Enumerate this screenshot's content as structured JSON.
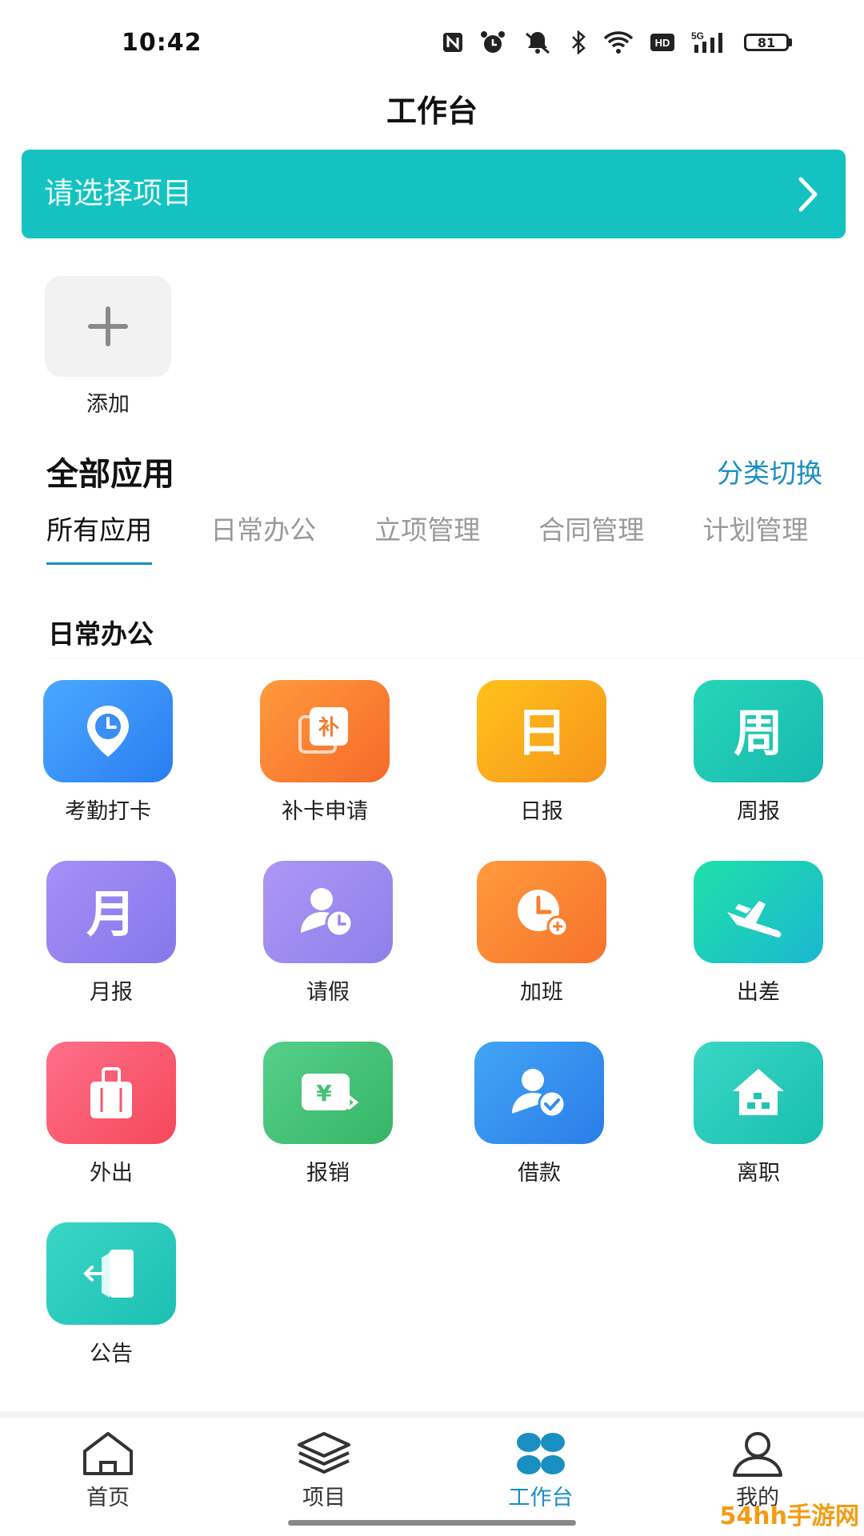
{
  "status_bar": {
    "time": "10:42",
    "battery": "81",
    "network": "5G",
    "hd": "HD"
  },
  "header": {
    "title": "工作台"
  },
  "project_selector": {
    "placeholder": "请选择项目"
  },
  "shortcut": {
    "add_label": "添加"
  },
  "all_apps": {
    "title": "全部应用",
    "switch_label": "分类切换"
  },
  "tabs": [
    {
      "label": "所有应用",
      "active": true
    },
    {
      "label": "日常办公",
      "active": false
    },
    {
      "label": "立项管理",
      "active": false
    },
    {
      "label": "合同管理",
      "active": false
    },
    {
      "label": "计划管理",
      "active": false
    }
  ],
  "group": {
    "title": "日常办公"
  },
  "apps": [
    {
      "label": "考勤打卡",
      "icon": "clock-pin-icon",
      "color": "#3a8ef6"
    },
    {
      "label": "补卡申请",
      "icon": "supplement-card-icon",
      "color": "#f77b2e",
      "glyph": "补"
    },
    {
      "label": "日报",
      "icon": "daily-report-icon",
      "color": "#f9a514",
      "glyph": "日"
    },
    {
      "label": "周报",
      "icon": "weekly-report-icon",
      "color": "#1bc6b0",
      "glyph": "周"
    },
    {
      "label": "月报",
      "icon": "monthly-report-icon",
      "color": "#9183f0",
      "glyph": "月"
    },
    {
      "label": "请假",
      "icon": "leave-user-clock-icon",
      "color": "#9a86ee"
    },
    {
      "label": "加班",
      "icon": "overtime-clock-icon",
      "color": "#f8802f"
    },
    {
      "label": "出差",
      "icon": "airplane-icon",
      "color": "#19cdb8"
    },
    {
      "label": "外出",
      "icon": "luggage-icon",
      "color": "#f5576c"
    },
    {
      "label": "报销",
      "icon": "reimburse-yen-icon",
      "color": "#43c274",
      "glyph": "¥"
    },
    {
      "label": "借款",
      "icon": "loan-user-check-icon",
      "color": "#2f8fef"
    },
    {
      "label": "离职",
      "icon": "resign-house-icon",
      "color": "#22c5b5"
    },
    {
      "label": "公告",
      "icon": "announcement-door-icon",
      "color": "#22c8b9"
    }
  ],
  "bottom_nav": [
    {
      "label": "首页",
      "icon": "home-icon",
      "active": false
    },
    {
      "label": "项目",
      "icon": "layers-icon",
      "active": false
    },
    {
      "label": "工作台",
      "icon": "workbench-grid-icon",
      "active": true
    },
    {
      "label": "我的",
      "icon": "user-icon",
      "active": false
    }
  ],
  "watermark": {
    "text": "54hh手游网"
  }
}
